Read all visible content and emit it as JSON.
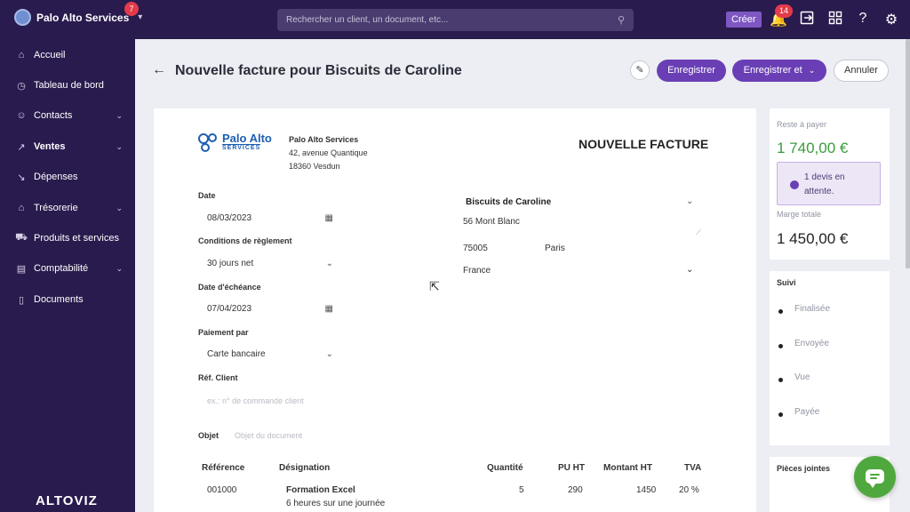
{
  "topbar": {
    "org_name": "Palo Alto Services",
    "org_badge": "7",
    "search_placeholder": "Rechercher un client, un document, etc...",
    "create_label": "Créer",
    "notif_count": "14"
  },
  "sidebar": {
    "items": [
      {
        "label": "Accueil",
        "icon": "home-icon"
      },
      {
        "label": "Tableau de bord",
        "icon": "dashboard-icon"
      },
      {
        "label": "Contacts",
        "icon": "user-icon"
      },
      {
        "label": "Ventes",
        "icon": "chart-icon"
      },
      {
        "label": "Dépenses",
        "icon": "chart-down-icon"
      },
      {
        "label": "Trésorerie",
        "icon": "bank-icon"
      },
      {
        "label": "Produits et services",
        "icon": "cart-icon"
      },
      {
        "label": "Comptabilité",
        "icon": "ledger-icon"
      },
      {
        "label": "Documents",
        "icon": "document-icon"
      }
    ],
    "brand": "ALTOVIZ"
  },
  "header": {
    "title": "Nouvelle facture pour Biscuits de Caroline",
    "save_label": "Enregistrer",
    "save_and_label": "Enregistrer et",
    "cancel_label": "Annuler"
  },
  "invoice": {
    "logo_line1": "Palo Alto",
    "logo_line2": "SERVICES",
    "company_name": "Palo Alto Services",
    "company_street": "42, avenue Quantique",
    "company_city": "18360 Vesdun",
    "doc_title": "NOUVELLE FACTURE",
    "date_label": "Date",
    "date_value": "08/03/2023",
    "terms_label": "Conditions de règlement",
    "terms_value": "30 jours net",
    "due_label": "Date d'échéance",
    "due_value": "07/04/2023",
    "payment_label": "Paiement par",
    "payment_value": "Carte bancaire",
    "ref_label": "Réf. Client",
    "ref_placeholder": "ex.: n° de commande client",
    "objet_label": "Objet",
    "objet_placeholder": "Objet du document",
    "client_name": "Biscuits de Caroline",
    "client_street": "56 Mont Blanc",
    "client_zip": "75005",
    "client_city": "Paris",
    "client_country": "France"
  },
  "table": {
    "headers": [
      "Référence",
      "Désignation",
      "Quantité",
      "PU HT",
      "Montant HT",
      "TVA"
    ],
    "row": {
      "ref": "001000",
      "designation": "Formation Excel",
      "description": "6 heures sur une journée",
      "qty": "5",
      "pu": "290",
      "amount": "1450",
      "tva": "20 %"
    }
  },
  "summary": {
    "remaining_label": "Reste à payer",
    "remaining_value": "1 740,00 €",
    "pending_text_1": "1 devis en",
    "pending_text_2": "attente.",
    "margin_label": "Marge totale",
    "margin_value": "1 450,00 €",
    "suivi_title": "Suivi",
    "suivi_items": [
      "Finalisée",
      "Envoyée",
      "Vue",
      "Payée"
    ],
    "attachments_title": "Pièces jointes"
  }
}
